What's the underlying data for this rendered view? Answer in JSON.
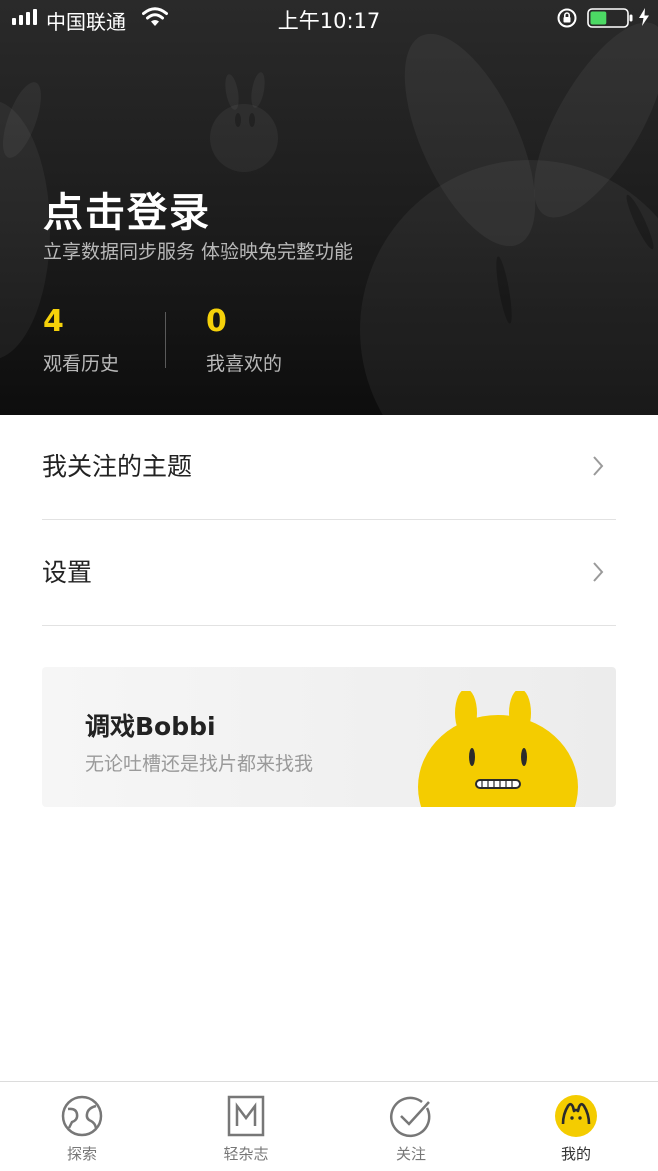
{
  "status_bar": {
    "carrier": "中国联通",
    "time": "上午10:17",
    "icons": [
      "signal-icon",
      "wifi-icon",
      "orientation-lock-icon",
      "battery-icon",
      "charging-icon"
    ],
    "battery_level": 0.45
  },
  "profile": {
    "login_title": "点击登录",
    "login_subtitle": "立享数据同步服务 体验映兔完整功能",
    "stats": [
      {
        "count": "4",
        "label": "观看历史"
      },
      {
        "count": "0",
        "label": "我喜欢的"
      }
    ]
  },
  "menu": {
    "items": [
      {
        "label": "我关注的主题",
        "icon": "chevron-right-icon"
      },
      {
        "label": "设置",
        "icon": "chevron-right-icon"
      }
    ]
  },
  "banner": {
    "title": "调戏Bobbi",
    "subtitle": "无论吐槽还是找片都来找我",
    "mascot": "bobbi-mascot"
  },
  "tabbar": {
    "tabs": [
      {
        "label": "探索",
        "icon": "globe-icon"
      },
      {
        "label": "轻杂志",
        "icon": "magazine-m-icon"
      },
      {
        "label": "关注",
        "icon": "check-circle-icon"
      },
      {
        "label": "我的",
        "icon": "bunny-avatar-icon",
        "active": true
      }
    ]
  },
  "colors": {
    "accent_yellow": "#f5d10a",
    "header_dark": "#1c1c1c",
    "battery_green": "#4cd964"
  }
}
